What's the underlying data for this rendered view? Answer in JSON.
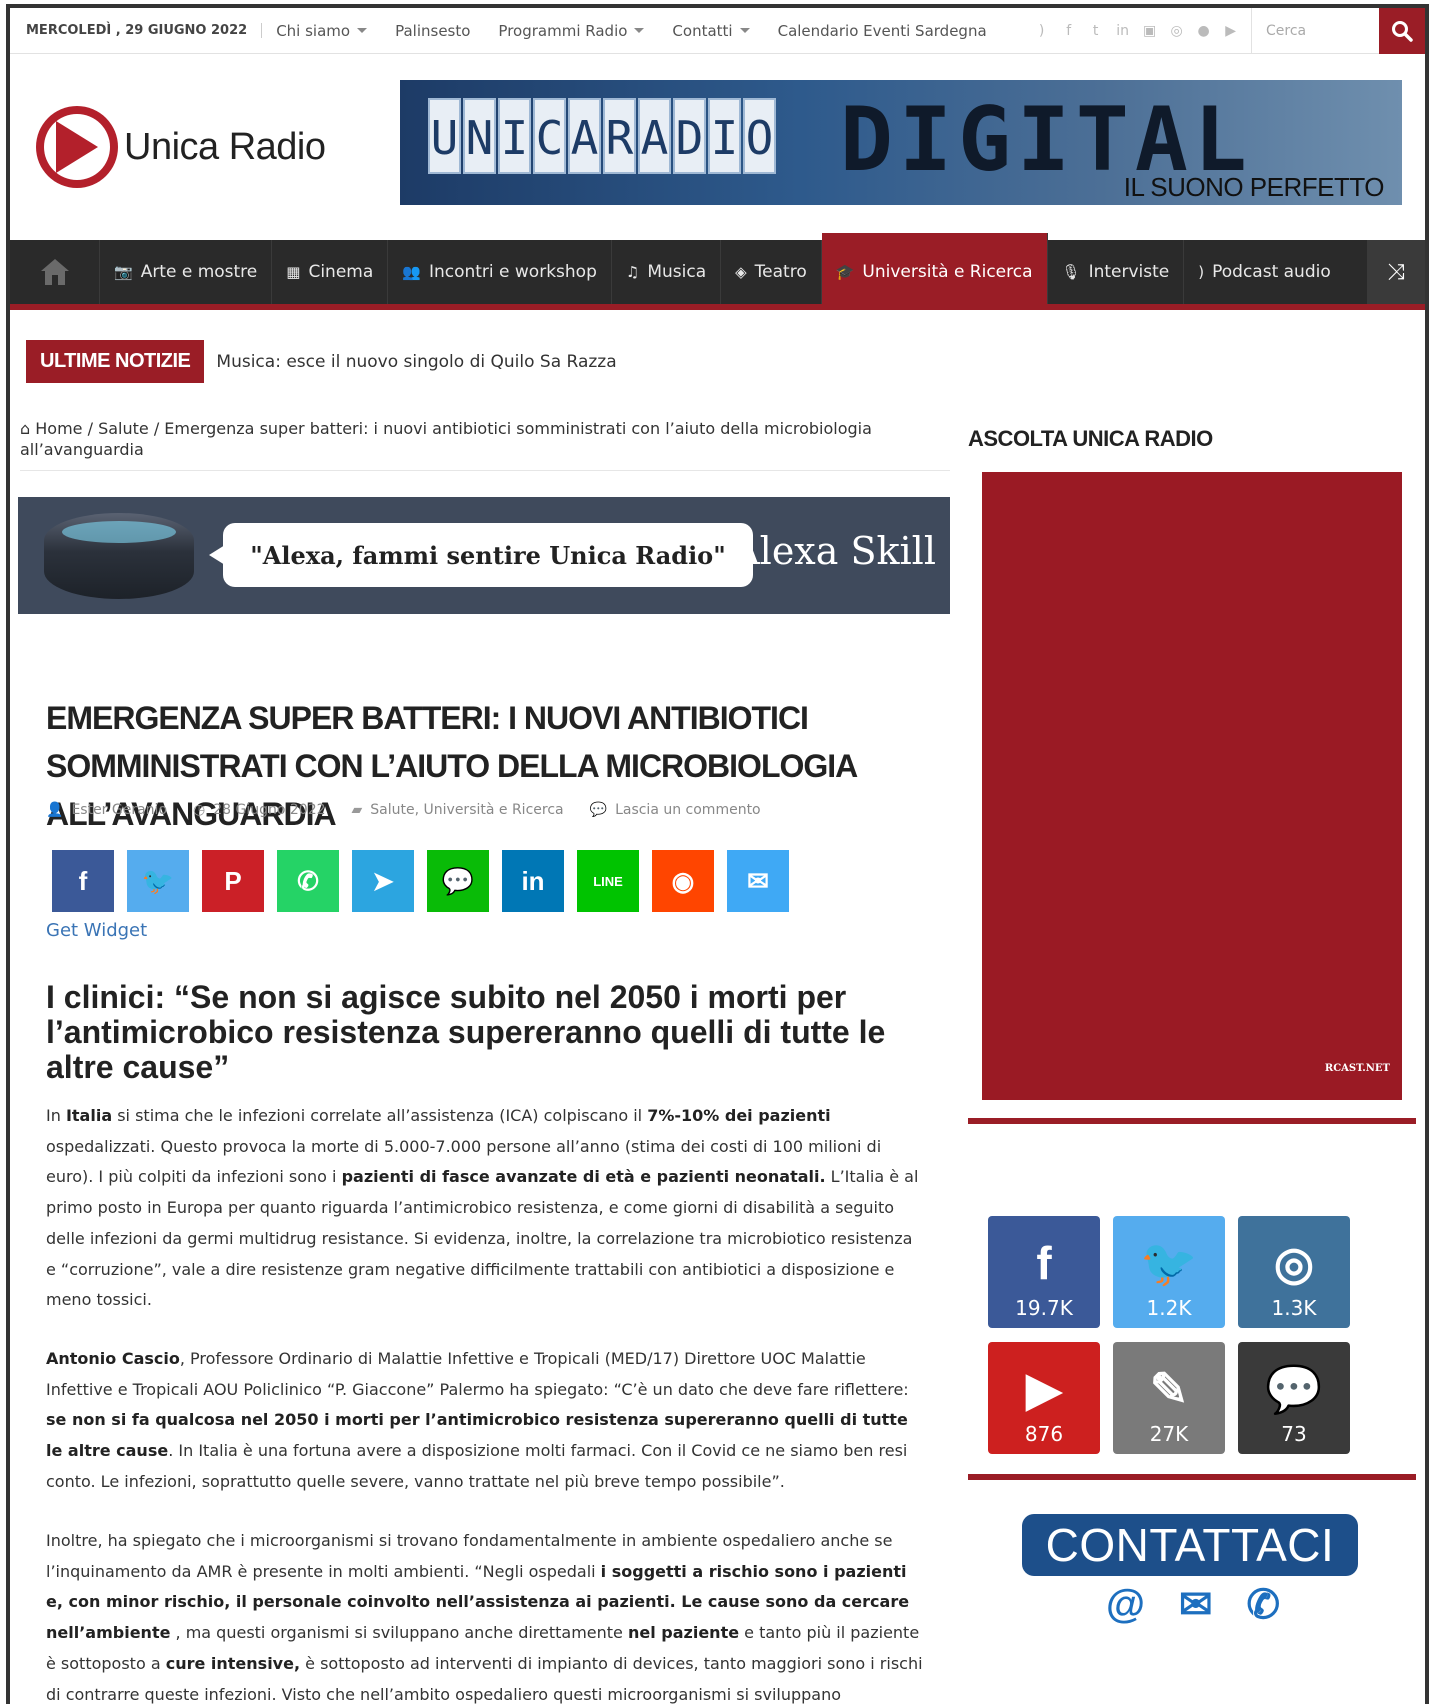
{
  "topbar": {
    "date": "MERCOLEDÌ , 29 GIUGNO 2022",
    "nav": [
      {
        "label": "Chi siamo",
        "dropdown": true
      },
      {
        "label": "Palinsesto",
        "dropdown": false
      },
      {
        "label": "Programmi Radio",
        "dropdown": true
      },
      {
        "label": "Contatti",
        "dropdown": true
      },
      {
        "label": "Calendario Eventi Sardegna",
        "dropdown": false
      }
    ],
    "social_icons": [
      "rss-icon",
      "facebook-icon",
      "twitter-icon",
      "linkedin-icon",
      "youtube-icon",
      "instagram-icon",
      "spotify-icon",
      "play-icon"
    ],
    "search_placeholder": "Cerca"
  },
  "header": {
    "logo_text": "Unica Radio",
    "banner": {
      "left": "UNICA RADIO",
      "right": "DIGITAL RADIO",
      "sub": "IL SUONO PERFETTO"
    }
  },
  "mainnav": {
    "items": [
      {
        "label": "Arte e mostre",
        "icon": "camera-icon"
      },
      {
        "label": "Cinema",
        "icon": "film-icon"
      },
      {
        "label": "Incontri e workshop",
        "icon": "group-icon"
      },
      {
        "label": "Musica",
        "icon": "music-icon"
      },
      {
        "label": "Teatro",
        "icon": "ticket-icon"
      },
      {
        "label": "Università e Ricerca",
        "icon": "graduation-cap-icon",
        "active": true
      },
      {
        "label": "Interviste",
        "icon": "microphone-icon"
      },
      {
        "label": "Podcast audio",
        "icon": "rss-icon"
      }
    ]
  },
  "breaking": {
    "tag": "ULTIME NOTIZIE",
    "text": "Musica: esce il nuovo singolo di Quilo Sa Razza"
  },
  "breadcrumb": {
    "home": "Home",
    "category": "Salute",
    "current": "Emergenza super batteri: i nuovi antibiotici somministrati con l’aiuto della microbiologia all’avanguardia"
  },
  "alexa": {
    "quote": "\"Alexa, fammi sentire Unica Radio\"",
    "skill": "Alexa Skill"
  },
  "article": {
    "title": "Emergenza super batteri: i nuovi antibiotici somministrati con l’aiuto della microbiologia all’avanguardia",
    "author": "Ester Geranio",
    "date": "28 Giugno 2022",
    "categories": "Salute, Università e Ricerca",
    "comments": "Lascia un commento",
    "share": [
      {
        "name": "facebook",
        "color": "#3b5998",
        "glyph": "f"
      },
      {
        "name": "twitter",
        "color": "#55acee",
        "glyph": "🐦"
      },
      {
        "name": "pinterest",
        "color": "#cb2027",
        "glyph": "P"
      },
      {
        "name": "whatsapp",
        "color": "#25d366",
        "glyph": "✆"
      },
      {
        "name": "telegram",
        "color": "#2ca5e0",
        "glyph": "➤"
      },
      {
        "name": "wechat",
        "color": "#09bb07",
        "glyph": "💬"
      },
      {
        "name": "linkedin",
        "color": "#0077b5",
        "glyph": "in"
      },
      {
        "name": "line",
        "color": "#00c300",
        "glyph": "LINE"
      },
      {
        "name": "reddit",
        "color": "#ff4500",
        "glyph": "◉"
      },
      {
        "name": "email",
        "color": "#3fa9f5",
        "glyph": "✉"
      }
    ],
    "get_widget": "Get Widget",
    "subtitle": "I clinici: “Se non si agisce subito nel 2050 i morti per l’antimicrobico resistenza supereranno quelli di tutte le altre cause”",
    "paragraphs": [
      [
        {
          "t": "In ",
          "b": false
        },
        {
          "t": "Italia",
          "b": true
        },
        {
          "t": " si stima che le infezioni correlate all’assistenza (ICA) colpiscano il ",
          "b": false
        },
        {
          "t": "7%-10% dei pazienti",
          "b": true
        },
        {
          "t": " ospedalizzati. Questo provoca la morte di 5.000-7.000 persone all’anno (stima dei costi di 100 milioni di euro). I più colpiti da infezioni sono i ",
          "b": false
        },
        {
          "t": "pazienti di fasce avanzate di età e pazienti neonatali.",
          "b": true
        },
        {
          "t": " L’Italia è al primo posto in Europa per quanto riguarda l’antimicrobico resistenza, e come giorni di disabilità a seguito delle infezioni da germi multidrug resistance. Si evidenza, inoltre, la correlazione tra microbiotico resistenza e “corruzione”, vale a dire resistenze gram negative difficilmente trattabili con antibiotici a disposizione e meno tossici.",
          "b": false
        }
      ],
      [
        {
          "t": "Antonio Cascio",
          "b": true
        },
        {
          "t": ", Professore Ordinario di Malattie Infettive e Tropicali (MED/17) Direttore UOC Malattie Infettive e Tropicali AOU Policlinico “P. Giaccone” Palermo ha spiegato: “C’è un dato che deve fare riflettere: ",
          "b": false
        },
        {
          "t": "se non si fa qualcosa nel 2050 i morti per l’antimicrobico resistenza supereranno quelli di tutte le altre cause",
          "b": true
        },
        {
          "t": ". In Italia è una fortuna avere a disposizione molti farmaci. Con il Covid ce ne siamo ben resi conto. Le infezioni, soprattutto quelle severe, vanno trattate nel più breve tempo possibile”.",
          "b": false
        }
      ],
      [
        {
          "t": "Inoltre, ha spiegato che i microorganismi si trovano fondamentalmente in ambiente ospedaliero anche se l’inquinamento da AMR è presente in molti ambienti. “Negli ospedali ",
          "b": false
        },
        {
          "t": "i soggetti a rischio sono i pazienti e, con minor rischio, il personale coinvolto nell’assistenza ai pazienti. Le cause sono da cercare nell’ambiente",
          "b": true
        },
        {
          "t": " , ma questi organismi si sviluppano anche direttamente ",
          "b": false
        },
        {
          "t": "nel paziente",
          "b": true
        },
        {
          "t": " e tanto più il paziente è sottoposto a ",
          "b": false
        },
        {
          "t": "cure intensive,",
          "b": true
        },
        {
          "t": " è sottoposto ad interventi di impianto di devices, tanto maggiori sono i rischi di contrarre queste infezioni. Visto che nell’ambito ospedaliero questi microorganismi si sviluppano",
          "b": false
        }
      ]
    ]
  },
  "sidebar": {
    "title": "ASCOLTA UNICA RADIO",
    "player_credit": "RCAST.NET",
    "counters": [
      {
        "name": "facebook",
        "count": "19.7K",
        "color": "#3b5998",
        "glyph": "f"
      },
      {
        "name": "twitter",
        "count": "1.2K",
        "color": "#55acee",
        "glyph": "🐦"
      },
      {
        "name": "instagram",
        "count": "1.3K",
        "color": "#3f729b",
        "glyph": "◎"
      },
      {
        "name": "youtube",
        "count": "876",
        "color": "#cd201f",
        "glyph": "▶"
      },
      {
        "name": "posts",
        "count": "27K",
        "color": "#7a7a7a",
        "glyph": "✎"
      },
      {
        "name": "comments",
        "count": "73",
        "color": "#3a3a3a",
        "glyph": "💬"
      }
    ],
    "contact_label": "CONTATTACI"
  }
}
